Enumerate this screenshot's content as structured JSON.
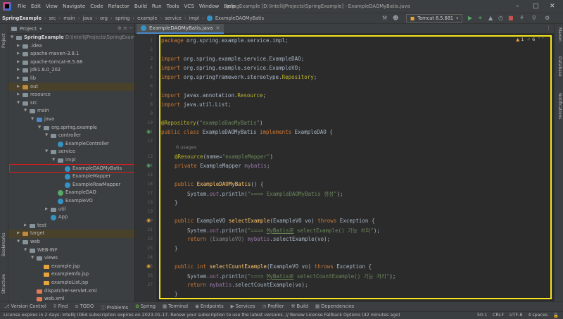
{
  "menu": [
    "File",
    "Edit",
    "View",
    "Navigate",
    "Code",
    "Refactor",
    "Build",
    "Run",
    "Tools",
    "VCS",
    "Window",
    "Help"
  ],
  "window_title": "SpringExample [D:\\IntelliJProjects\\SpringExample] - ExampleDAOMyBatis.java",
  "breadcrumbs": [
    "SpringExample",
    "src",
    "main",
    "java",
    "org",
    "spring",
    "example",
    "service",
    "impl",
    "ExampleDAOMyBatis"
  ],
  "run_config": "Tomcat 8.5.681",
  "left_strip": [
    "Project",
    "Bookmarks",
    "Structure"
  ],
  "right_strip": [
    "Maven",
    "Database",
    "Notifications"
  ],
  "project_panel": {
    "title": "Project",
    "root_name": "SpringExample",
    "root_path": "D:\\IntelliJProjects\\SpringExample"
  },
  "tree": [
    {
      "label": ".idea"
    },
    {
      "label": "apache-maven-3.8.1"
    },
    {
      "label": "apache-tomcat-8.5.68"
    },
    {
      "label": "jdk1.8.0_202"
    },
    {
      "label": "lib"
    },
    {
      "label": "out"
    },
    {
      "label": "resource"
    },
    {
      "label": "src"
    },
    {
      "label": "main"
    },
    {
      "label": "java"
    },
    {
      "label": "org.spring.example"
    },
    {
      "label": "controller"
    },
    {
      "label": "ExampleController"
    },
    {
      "label": "service"
    },
    {
      "label": "impl"
    },
    {
      "label": "ExampleDAOMyBatis"
    },
    {
      "label": "ExampleMapper"
    },
    {
      "label": "ExampleRowMapper"
    },
    {
      "label": "ExampleDAO"
    },
    {
      "label": "ExampleVO"
    },
    {
      "label": "util"
    },
    {
      "label": "App"
    },
    {
      "label": "test"
    },
    {
      "label": "target"
    },
    {
      "label": "web"
    },
    {
      "label": "WEB-INF"
    },
    {
      "label": "views"
    },
    {
      "label": "example.jsp"
    },
    {
      "label": "exampleInfo.jsp"
    },
    {
      "label": "exampleList.jsp"
    },
    {
      "label": "dispatcher-servlet.xml"
    },
    {
      "label": "web.xml"
    }
  ],
  "editor_tab": "ExampleDAOMyBatis.java",
  "inspections": {
    "warnings": "1",
    "weak": "6"
  },
  "line_numbers": [
    "1",
    "2",
    "3",
    "4",
    "5",
    "6",
    "7",
    "8",
    "9",
    "10",
    "11",
    "12",
    "13",
    "14",
    "15",
    "16",
    "17",
    "18",
    "19",
    "20",
    "21",
    "22",
    "23",
    "24",
    "25",
    "26",
    "27"
  ],
  "code": {
    "l1_kw": "package",
    "l1": " org.spring.example.service.impl;",
    "l3_kw": "import",
    "l3": " org.spring.example.service.ExampleDAO;",
    "l4_kw": "import",
    "l4": " org.spring.example.service.ExampleVO;",
    "l5_kw": "import",
    "l5": " org.springframework.stereotype.",
    "l5_cls": "Repository",
    "l5_end": ";",
    "l7_kw": "import",
    "l7": " javax.annotation.",
    "l7_cls": "Resource",
    "l7_end": ";",
    "l8_kw": "import",
    "l8": " java.util.List;",
    "l10_an": "@Repository",
    "l10_p1": "(",
    "l10_str": "\"exampleDaoMyBatis\"",
    "l10_p2": ")",
    "l11_kw": "public class",
    "l11_name": " ExampleDAOMyBatis ",
    "l11_kw2": "implements",
    "l11_end": " ExampleDAO {",
    "usages": "6 usages",
    "l13_an": "@Resource",
    "l13_p1": "(name=",
    "l13_str": "\"exampleMapper\"",
    "l13_p2": ")",
    "l14_kw": "private",
    "l14_type": " ExampleMapper ",
    "l14_field": "mybatis",
    "l14_end": ";",
    "l16_kw": "public",
    "l16_fn": " ExampleDAOMyBatis",
    "l16_end": "() {",
    "l17_a": "System.",
    "l17_out": "out",
    "l17_b": ".println(",
    "l17_str": "\"===> ExampleDAOMyBatis 생성\"",
    "l17_end": ");",
    "close": "}",
    "l20_kw": "public",
    "l20_type": " ExampleVO ",
    "l20_fn": "selectExample",
    "l20_args": "(ExampleVO vo) ",
    "l20_kw2": "throws",
    "l20_end": " Exception {",
    "l21_str_a": "\"===> ",
    "l21_str_u": "MyBatis로",
    "l21_str_b": " selectExample() 기능 처리\"",
    "l22_kw": "return",
    "l22_a": " (ExampleVO) ",
    "l22_field": "mybatis",
    "l22_b": ".selectExample(vo);",
    "l25_kw": "public int",
    "l25_fn": " selectCountExample",
    "l25_args": "(ExampleVO vo) ",
    "l25_kw2": "throws",
    "l25_end": " Exception {",
    "l26_str_a": "\"===> ",
    "l26_str_u": "MyBatis로",
    "l26_str_b": " selectCountExample() 기능 처리\"",
    "l27_kw": "return",
    "l27_field": " mybatis",
    "l27_b": ".selectCountExample(vo);"
  },
  "tool_windows": [
    "Version Control",
    "Find",
    "TODO",
    "Problems",
    "Spring",
    "Terminal",
    "Endpoints",
    "Services",
    "Profiler",
    "Build",
    "Dependencies"
  ],
  "status": {
    "message": "License expires in 2 days: IntelliJ IDEA subscription expires on 2023-01-17. Renew your subscription to use the latest versions. // Renew License   Fallback Options (42 minutes ago)",
    "position": "50:1",
    "line_sep": "CRLF",
    "encoding": "UTF-8",
    "indent": "4 spaces"
  },
  "colors": {
    "highlight_box": "#f5e61a",
    "selection_box": "#e0191b",
    "keyword": "#cc7832",
    "string": "#6a8759"
  }
}
